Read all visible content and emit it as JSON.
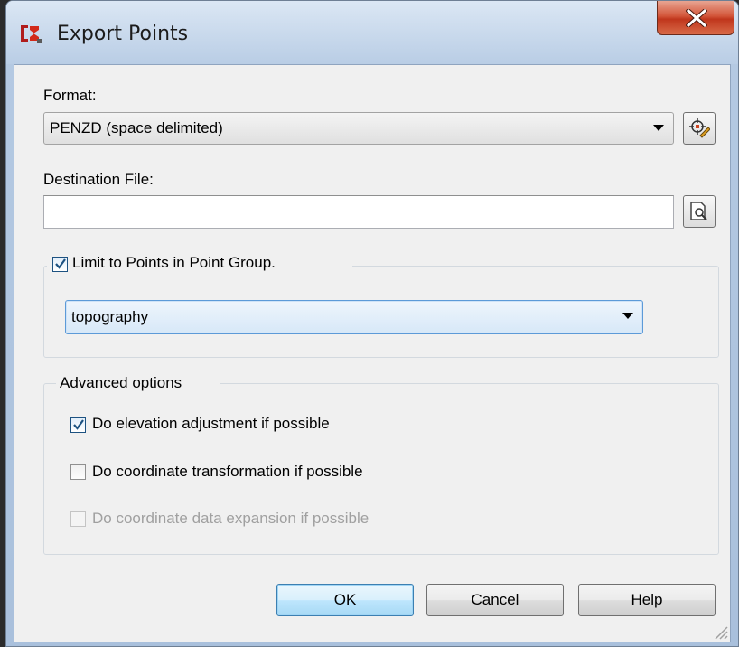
{
  "window": {
    "title": "Export Points",
    "icon": "civil3d-app-icon",
    "close_label": "X"
  },
  "format": {
    "label": "Format:",
    "value": "PENZD (space delimited)",
    "edit_icon": "format-edit-icon"
  },
  "destination": {
    "label": "Destination File:",
    "value": "",
    "placeholder": "",
    "browse_icon": "browse-file-icon"
  },
  "point_group": {
    "checkbox_label": "Limit to Points in Point Group.",
    "checked": true,
    "value": "topography"
  },
  "advanced": {
    "legend": "Advanced options",
    "options": [
      {
        "label": "Do elevation adjustment if possible",
        "checked": true,
        "enabled": true
      },
      {
        "label": "Do coordinate transformation if possible",
        "checked": false,
        "enabled": true
      },
      {
        "label": "Do coordinate data expansion if possible",
        "checked": false,
        "enabled": false
      }
    ]
  },
  "buttons": {
    "ok": "OK",
    "cancel": "Cancel",
    "help": "Help"
  },
  "colors": {
    "accent": "#3c7fb1",
    "close_red": "#c0361c",
    "checkmark": "#1d5281"
  }
}
